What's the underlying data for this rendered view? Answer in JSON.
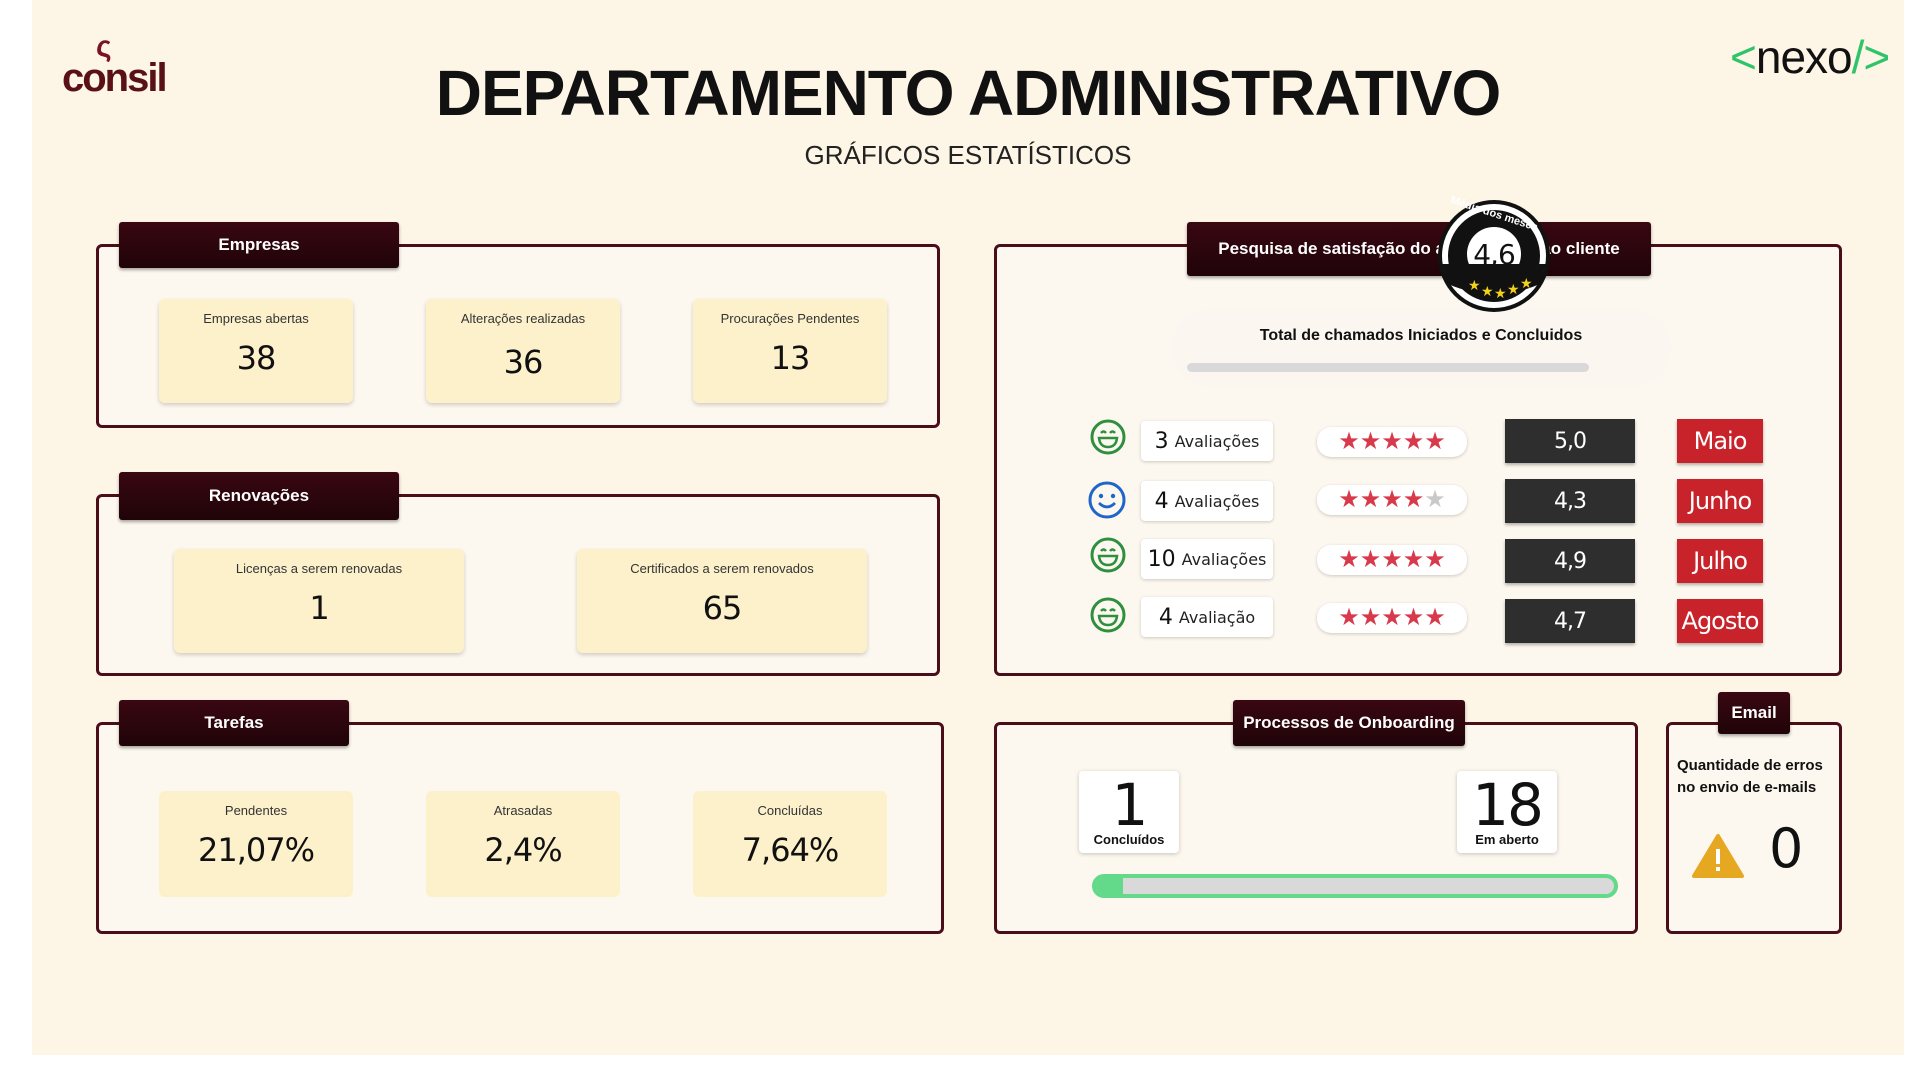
{
  "header": {
    "logo_left": "consil",
    "logo_right": "nexo",
    "title": "DEPARTAMENTO ADMINISTRATIVO",
    "subtitle": "GRÁFICOS ESTATÍSTICOS"
  },
  "empresas": {
    "tag": "Empresas",
    "cards": [
      {
        "label": "Empresas abertas",
        "value": "38"
      },
      {
        "label": "Alterações realizadas",
        "value": "36"
      },
      {
        "label": "Procurações Pendentes",
        "value": "13"
      }
    ]
  },
  "renovacoes": {
    "tag": "Renovações",
    "cards": [
      {
        "label": "Licenças a serem renovadas",
        "value": "1"
      },
      {
        "label": "Certificados a serem renovados",
        "value": "65"
      }
    ]
  },
  "tarefas": {
    "tag": "Tarefas",
    "cards": [
      {
        "label": "Pendentes",
        "value": "21,07%"
      },
      {
        "label": "Atrasadas",
        "value": "2,4%"
      },
      {
        "label": "Concluídas",
        "value": "7,64%"
      }
    ]
  },
  "satisfacao": {
    "tag": "Pesquisa de satisfação do atendimento ao cliente",
    "total_label": "Total de chamados Iniciados e Concluidos",
    "badge_text": "Média dos meses",
    "badge_value": "4,6",
    "rows": [
      {
        "face": "grin-face-icon",
        "count": "3",
        "count_label": "Avaliações",
        "stars": 5,
        "score": "5,0",
        "month": "Maio"
      },
      {
        "face": "smile-face-icon",
        "count": "4",
        "count_label": "Avaliações",
        "stars": 4.5,
        "score": "4,3",
        "month": "Junho"
      },
      {
        "face": "grin-face-icon",
        "count": "10",
        "count_label": "Avaliações",
        "stars": 5,
        "score": "4,9",
        "month": "Julho"
      },
      {
        "face": "grin-face-icon",
        "count": "4",
        "count_label": "Avaliação",
        "stars": 5,
        "score": "4,7",
        "month": "Agosto"
      }
    ]
  },
  "onboarding": {
    "tag": "Processos de Onboarding",
    "concluidos_value": "1",
    "concluidos_label": "Concluídos",
    "aberto_value": "18",
    "aberto_label": "Em aberto",
    "progress_fraction": 0.0526
  },
  "email": {
    "tag": "Email",
    "question": "Quantidade de erros no envio de e-mails",
    "value": "0"
  },
  "colors": {
    "background": "#fdf5e6",
    "maroon": "#4a0e1a",
    "card": "#fdf1cc",
    "star": "#d83a4c",
    "month": "#c8232a",
    "score": "#2e2e2e",
    "progress": "#63d98a",
    "green_face": "#2f8f3f",
    "blue_face": "#1e66c8",
    "warning": "#e6a820"
  }
}
